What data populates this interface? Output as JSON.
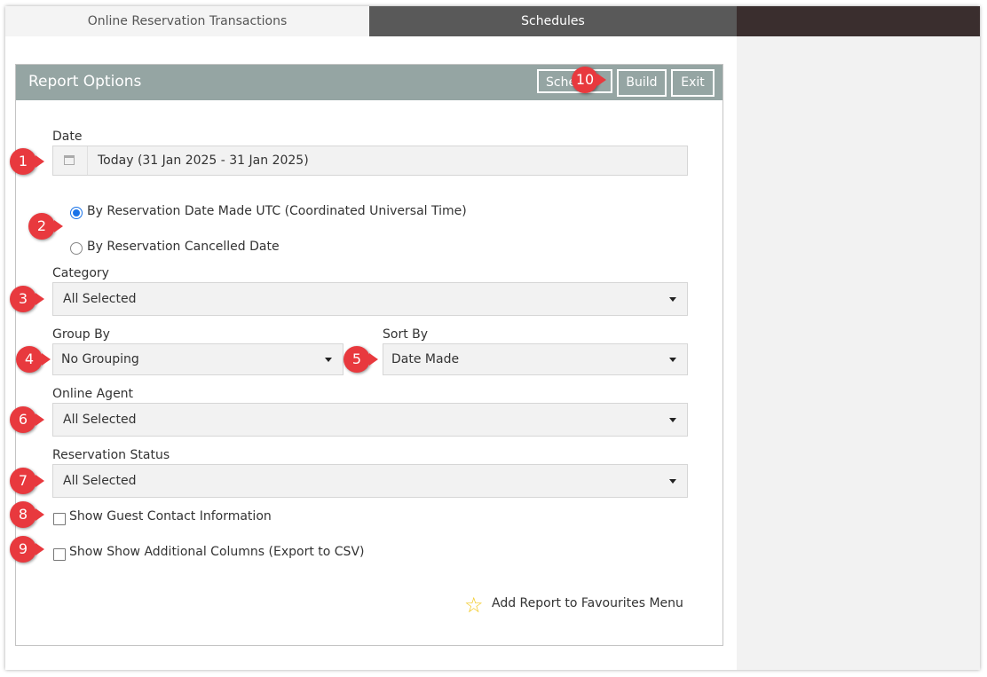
{
  "tabs": [
    {
      "label": "Online Reservation Transactions",
      "active": true
    },
    {
      "label": "Schedules",
      "active": false
    }
  ],
  "panel": {
    "title": "Report Options",
    "buttons": {
      "schedule": "Sche",
      "build": "Build",
      "exit": "Exit"
    }
  },
  "form": {
    "date_label": "Date",
    "date_value": "Today (31 Jan 2025 - 31 Jan 2025)",
    "radio_options": [
      {
        "label": "By Reservation Date Made UTC (Coordinated Universal Time)",
        "selected": true
      },
      {
        "label": "By Reservation Cancelled Date",
        "selected": false
      }
    ],
    "category_label": "Category",
    "category_value": "All Selected",
    "group_by_label": "Group By",
    "group_by_value": "No Grouping",
    "sort_by_label": "Sort By",
    "sort_by_value": "Date Made",
    "online_agent_label": "Online Agent",
    "online_agent_value": "All Selected",
    "reservation_status_label": "Reservation Status",
    "reservation_status_value": "All Selected",
    "checkboxes": [
      {
        "label": "Show Guest Contact Information",
        "checked": false
      },
      {
        "label": "Show Show Additional Columns (Export to CSV)",
        "checked": false
      }
    ],
    "favourites_label": "Add Report to Favourites Menu"
  },
  "markers": [
    "1",
    "2",
    "3",
    "4",
    "5",
    "6",
    "7",
    "8",
    "9",
    "10"
  ],
  "colors": {
    "marker": "#e8393e",
    "header": "#95a5a3",
    "radio_selected": "#1a73e8",
    "star": "#f2c81c"
  }
}
